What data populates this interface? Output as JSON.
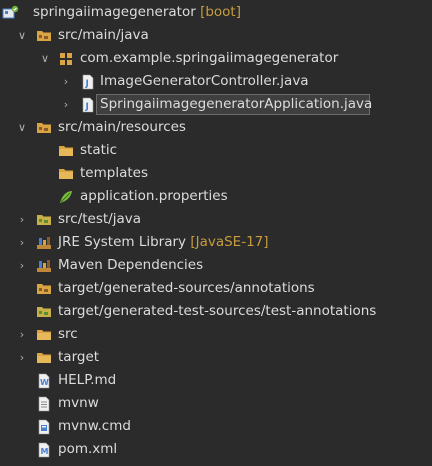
{
  "project_explorer": {
    "items": [
      {
        "label": "springaiimagegenerator",
        "decoration": "[boot]",
        "icon": "boot-project-icon",
        "expanded": true
      },
      {
        "label": "src/main/java",
        "icon": "source-folder-icon",
        "expanded": true
      },
      {
        "label": "com.example.springaiimagegenerator",
        "icon": "package-icon",
        "expanded": true
      },
      {
        "label": "ImageGeneratorController.java",
        "icon": "java-file-icon",
        "expanded": false
      },
      {
        "label": "SpringaiimagegeneratorApplication.java",
        "icon": "java-file-icon",
        "expanded": false,
        "selected": true
      },
      {
        "label": "src/main/resources",
        "icon": "source-folder-icon",
        "expanded": true
      },
      {
        "label": "static",
        "icon": "folder-icon"
      },
      {
        "label": "templates",
        "icon": "folder-icon"
      },
      {
        "label": "application.properties",
        "icon": "properties-file-icon"
      },
      {
        "label": "src/test/java",
        "icon": "test-source-folder-icon",
        "expanded": false
      },
      {
        "label": "JRE System Library",
        "decoration": "[JavaSE-17]",
        "icon": "library-icon",
        "expanded": false
      },
      {
        "label": "Maven Dependencies",
        "icon": "library-icon",
        "expanded": false
      },
      {
        "label": "target/generated-sources/annotations",
        "icon": "source-folder-icon"
      },
      {
        "label": "target/generated-test-sources/test-annotations",
        "icon": "test-source-folder-icon"
      },
      {
        "label": "src",
        "icon": "folder-icon",
        "expanded": false
      },
      {
        "label": "target",
        "icon": "folder-icon",
        "expanded": false
      },
      {
        "label": "HELP.md",
        "icon": "markdown-file-icon"
      },
      {
        "label": "mvnw",
        "icon": "text-file-icon"
      },
      {
        "label": "mvnw.cmd",
        "icon": "cmd-file-icon"
      },
      {
        "label": "pom.xml",
        "icon": "maven-pom-icon"
      }
    ]
  },
  "colors": {
    "background": "#2b2b2b",
    "text": "#dcdcdc",
    "decoration": "#c69c3f",
    "folder": "#d9a441",
    "java_file": "#4a7fd0",
    "selection": "#3f3f3f"
  }
}
